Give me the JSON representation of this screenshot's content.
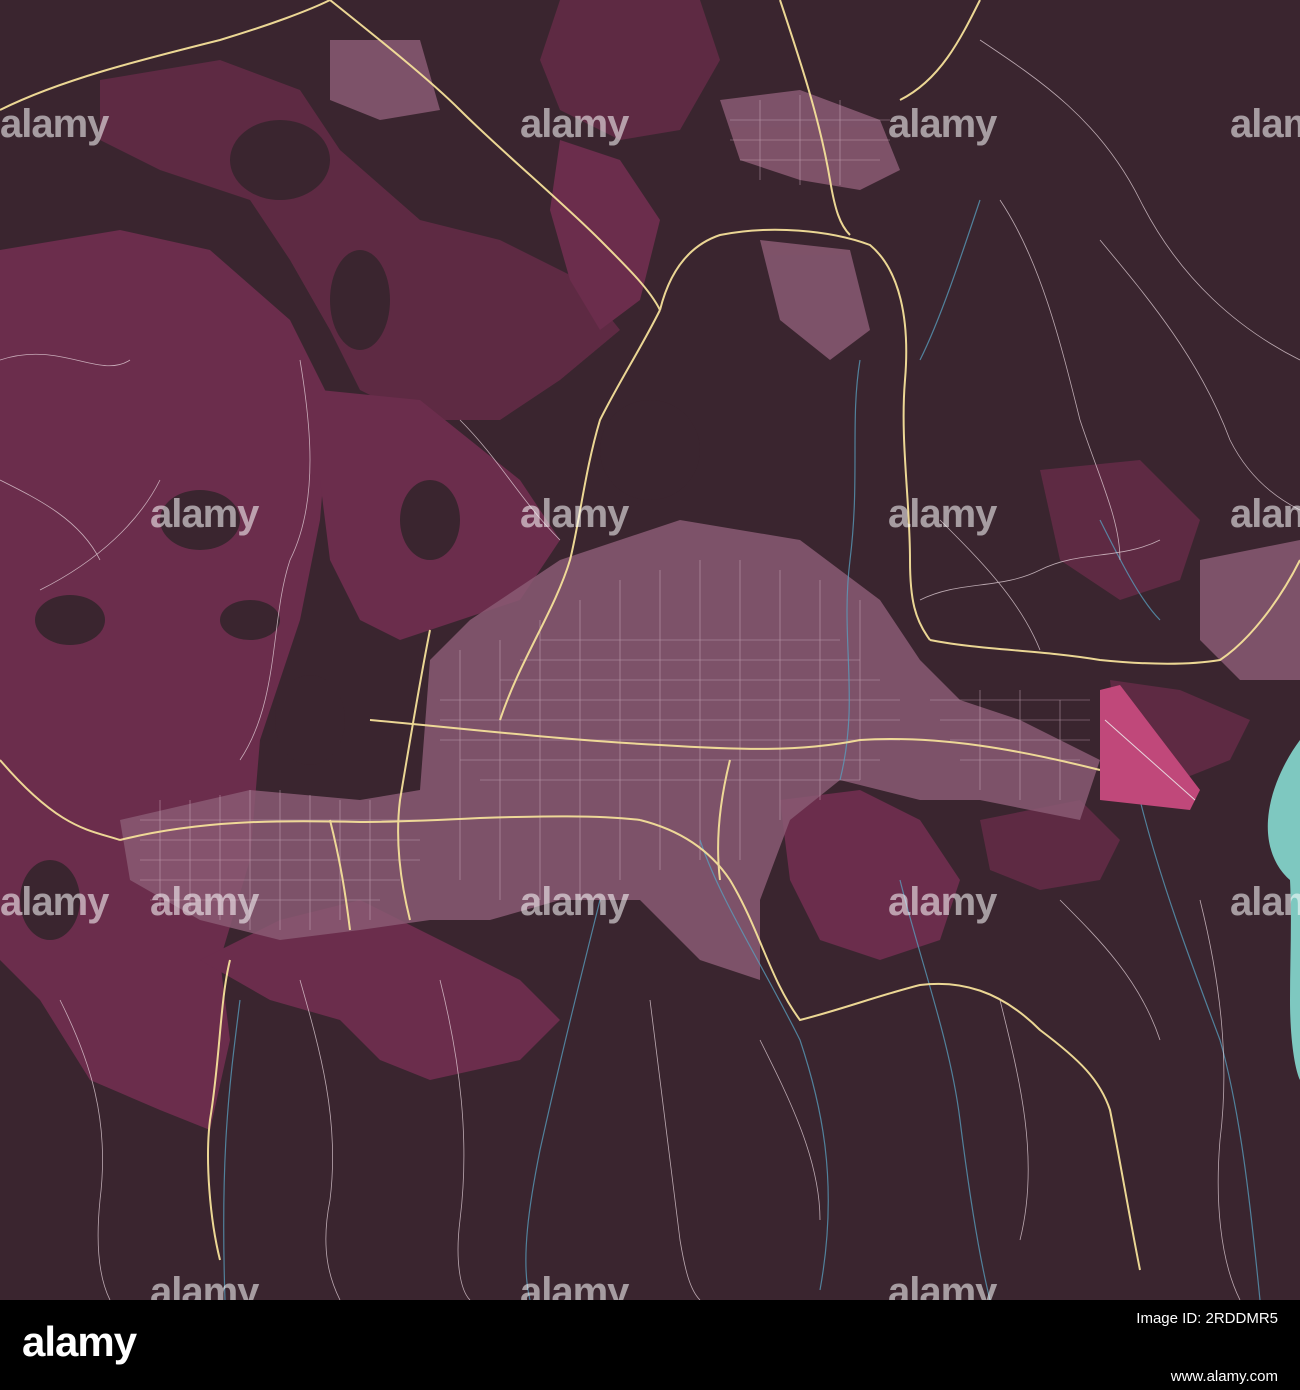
{
  "map": {
    "colors": {
      "background": "#3a252f",
      "land_light": "#6b2d4c",
      "land_mid": "#5e2a43",
      "urban": "#d8b8c8",
      "roads_major": "#f5e09a",
      "roads_minor": "#e8d6dd",
      "streams": "#5aa0c0",
      "water": "#7ec8c0",
      "airport": "#c0487a"
    }
  },
  "watermark": {
    "text": "alamy",
    "color": "#ffffff"
  },
  "footer": {
    "logo": "alamy",
    "image_id": "Image ID: 2RDDMR5",
    "url": "www.alamy.com",
    "background": "#000000"
  }
}
